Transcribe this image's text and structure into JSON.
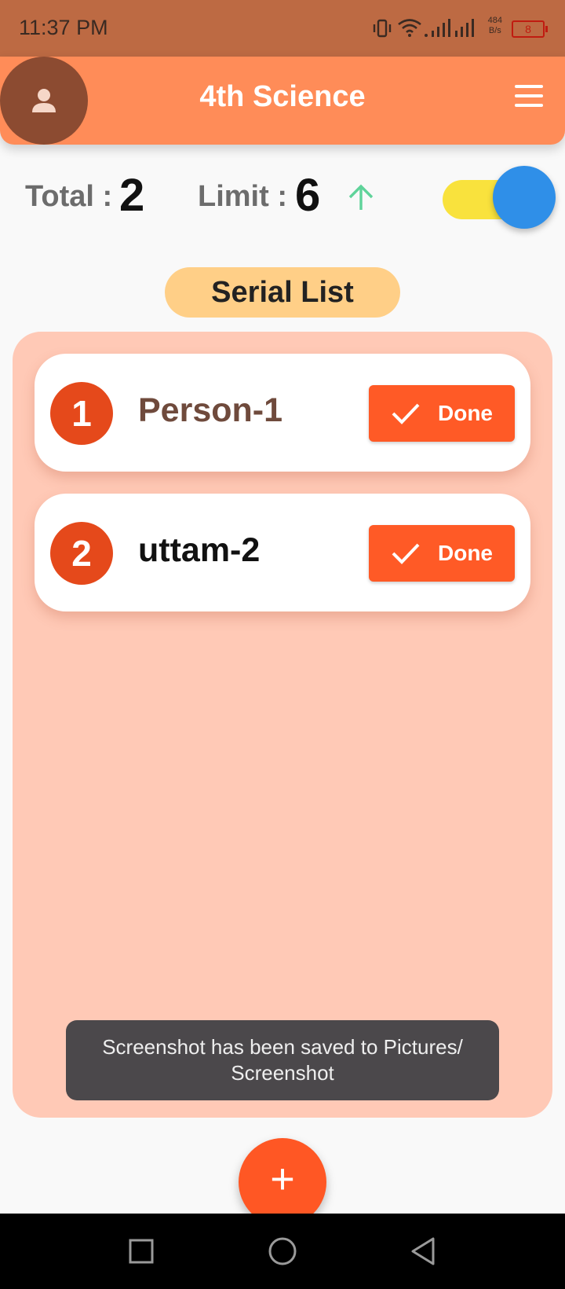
{
  "status_bar": {
    "time": "11:37 PM",
    "speed_value": "484",
    "speed_unit": "B/s",
    "battery": "8",
    "icons": [
      "vibrate-icon",
      "wifi-icon",
      "signal-icon",
      "signal-icon",
      "battery-icon"
    ]
  },
  "header": {
    "title": "4th Science",
    "avatar_icon": "person-icon",
    "menu_icon": "hamburger-menu-icon",
    "color": "#ff8c58"
  },
  "stats": {
    "total_label": "Total :",
    "total_value": "2",
    "limit_label": "Limit :",
    "limit_value": "6",
    "toggle_on": true
  },
  "serial_list_title": "Serial List",
  "list": {
    "items": [
      {
        "number": "1",
        "name": "Person-1",
        "button": "Done"
      },
      {
        "number": "2",
        "name": "uttam-2",
        "button": "Done"
      }
    ]
  },
  "toast": {
    "line1": "Screenshot has been saved to  Pictures/",
    "line2": "Screenshot"
  },
  "fab": {
    "label": "+"
  },
  "nav": {
    "items": [
      "recent-apps",
      "home",
      "back"
    ]
  },
  "colors": {
    "accent": "#ff5a26",
    "panel": "#ffc9b6",
    "pill": "#ffcf87",
    "status_bar": "#bd6a43"
  }
}
